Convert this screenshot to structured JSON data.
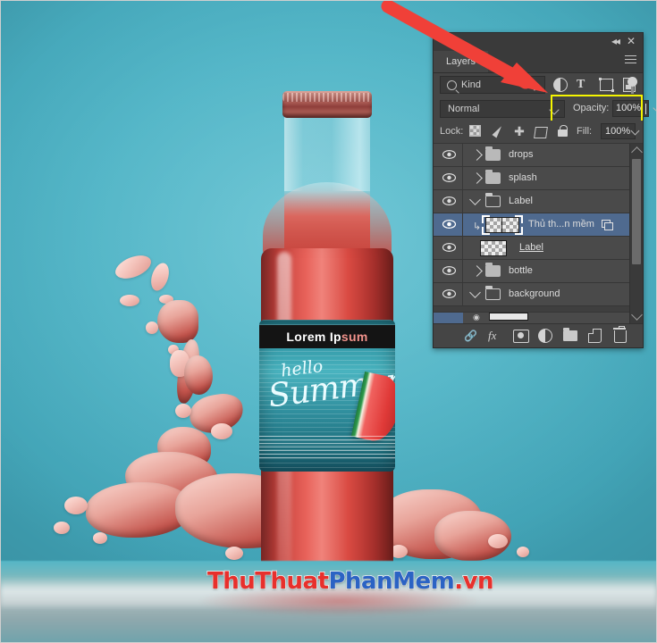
{
  "photo": {
    "background_color": "#4fb8c9",
    "bottle_label": {
      "title_dark": "Lorem Ip",
      "title_light": "sum",
      "script_line1": "hello",
      "script_line2": "Summer"
    },
    "watermark": {
      "part1": "ThuThuat",
      "part2": "PhanMem",
      "part3": ".vn",
      "color1": "#e8302c",
      "color2": "#2b63c4",
      "color3": "#e8302c"
    }
  },
  "annotation": {
    "arrow_color": "#f04038",
    "highlight_color": "#f5f500"
  },
  "panel": {
    "title_tab": "Layers",
    "collapse_icon": "collapse-icon",
    "close_icon": "close-icon",
    "menu_icon": "panel-menu-icon",
    "filter": {
      "search_icon": "search-icon",
      "kind_label": "Kind",
      "kind_chevron": "chevron-down-icon",
      "buttons": [
        {
          "name": "filter-adjustment-icon",
          "label": "adjustment"
        },
        {
          "name": "filter-type-icon",
          "label": "T"
        },
        {
          "name": "filter-shape-icon",
          "label": "shape"
        },
        {
          "name": "filter-smart-object-icon",
          "label": "smart-object"
        }
      ],
      "toggle_icon": "filter-toggle-icon"
    },
    "blend": {
      "mode": "Normal",
      "mode_chevron": "chevron-down-icon",
      "opacity_label": "Opacity:",
      "opacity_value": "100%",
      "opacity_chevron": "chevron-down-icon"
    },
    "lock": {
      "label": "Lock:",
      "icons": [
        "lock-transparent-pixels-icon",
        "lock-image-pixels-icon",
        "lock-position-icon",
        "lock-artboard-icon",
        "lock-all-icon"
      ],
      "fill_label": "Fill:",
      "fill_value": "100%",
      "fill_chevron": "chevron-down-icon"
    },
    "layers": [
      {
        "name": "drops",
        "type": "group",
        "visible": true,
        "expanded": false,
        "selected": false,
        "indent": 0
      },
      {
        "name": "splash",
        "type": "group",
        "visible": true,
        "expanded": false,
        "selected": false,
        "indent": 0
      },
      {
        "name": "Label",
        "type": "group",
        "visible": true,
        "expanded": true,
        "selected": false,
        "indent": 0
      },
      {
        "name": "Thủ th...n mềm",
        "type": "smart-object",
        "visible": true,
        "selected": true,
        "clipped": true,
        "indent": 1
      },
      {
        "name": "Label",
        "type": "layer",
        "visible": true,
        "selected": false,
        "indent": 1,
        "underline": true
      },
      {
        "name": "bottle",
        "type": "group",
        "visible": true,
        "expanded": false,
        "selected": false,
        "indent": 0
      },
      {
        "name": "background",
        "type": "group",
        "visible": true,
        "expanded": true,
        "selected": false,
        "indent": 0
      }
    ],
    "scrollbar": {
      "up_arrow": "scroll-up-arrow-icon",
      "down_arrow": "scroll-down-arrow-icon"
    },
    "footer_buttons": [
      "link-layers-icon",
      "layer-style-fx-icon",
      "add-layer-mask-icon",
      "new-adjustment-layer-icon",
      "new-group-icon",
      "new-layer-icon",
      "delete-layer-icon"
    ]
  }
}
